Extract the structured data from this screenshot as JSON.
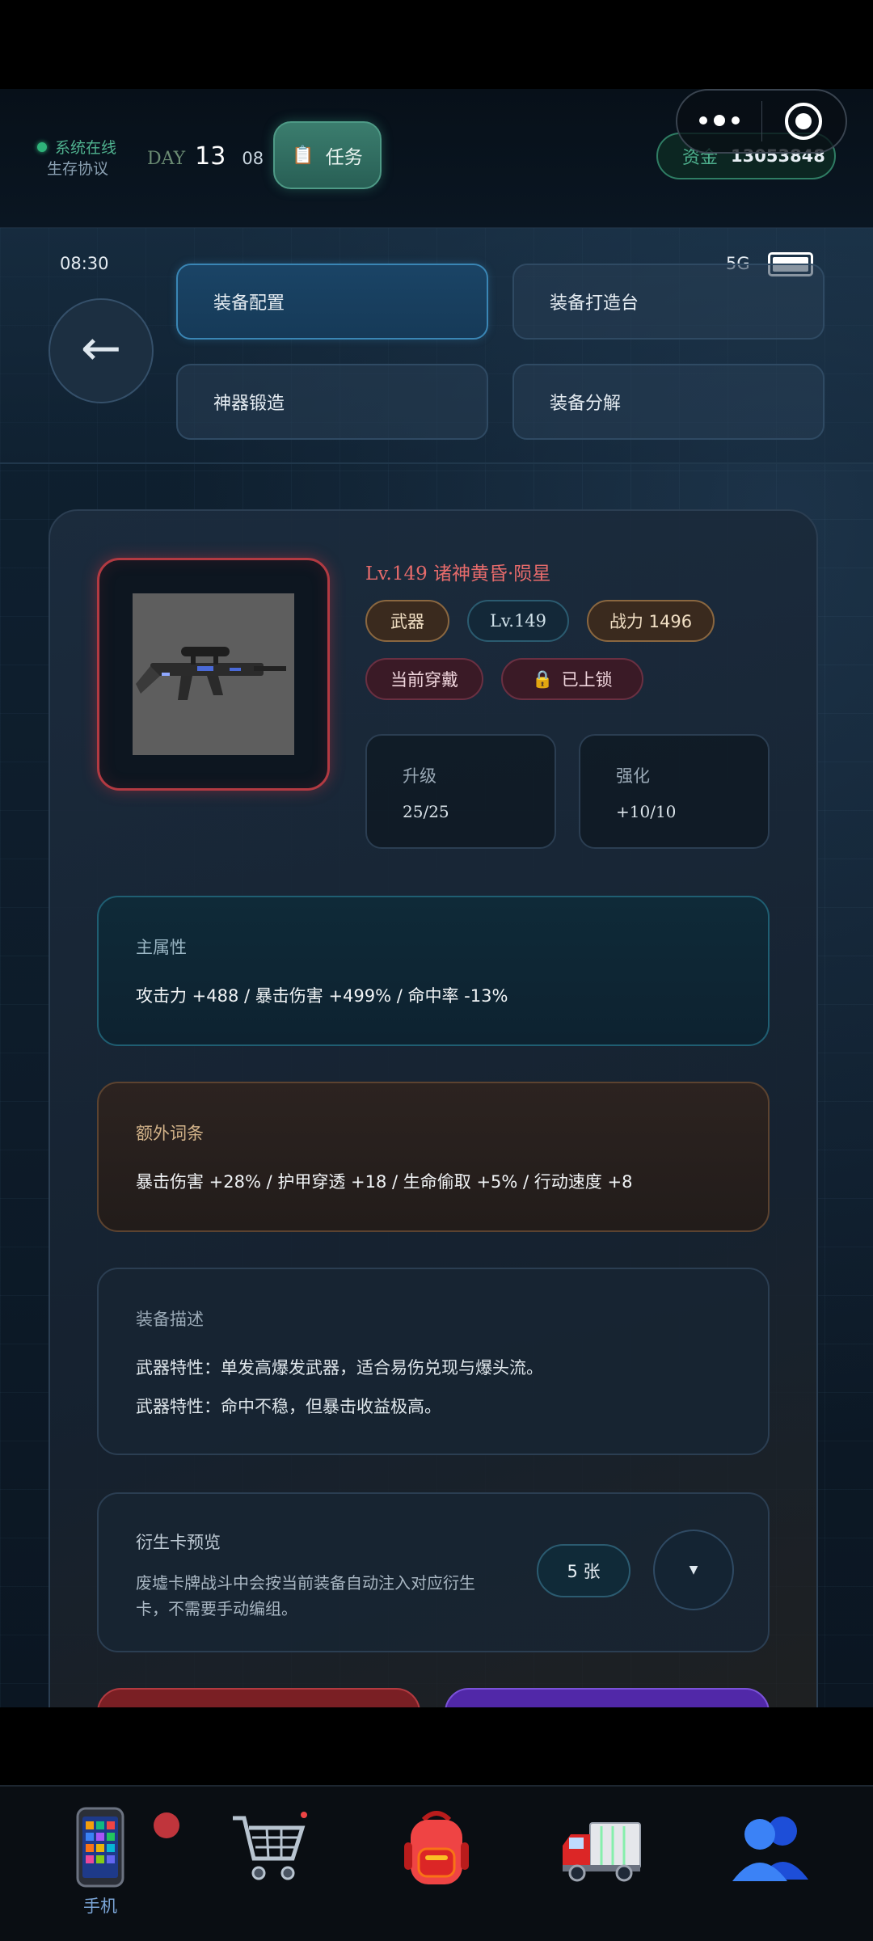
{
  "header": {
    "system_status": "系统在线",
    "protocol": "生存协议",
    "day_label": "DAY",
    "day_number": "13",
    "hour": "08",
    "task_button": "任务",
    "funds_label": "资金",
    "funds_value": "13053848"
  },
  "phone_status": {
    "time": "08:30",
    "network": "5G"
  },
  "nav": {
    "tiles": [
      {
        "label": "装备配置"
      },
      {
        "label": "装备打造台"
      },
      {
        "label": "神器锻造"
      },
      {
        "label": "装备分解"
      }
    ]
  },
  "item": {
    "title": "Lv.149 诸神黄昏·陨星",
    "tags": {
      "type": "武器",
      "level": "Lv.149",
      "power": "战力 1496",
      "equipped": "当前穿戴",
      "locked": "已上锁"
    },
    "upgrade_label": "升级",
    "upgrade_value": "25/25",
    "enhance_label": "强化",
    "enhance_value": "+10/10"
  },
  "sections": {
    "main_title": "主属性",
    "main_body": "攻击力 +488 / 暴击伤害 +499% / 命中率 -13%",
    "extra_title": "额外词条",
    "extra_body": "暴击伤害 +28% / 护甲穿透 +18 / 生命偷取 +5% / 行动速度 +8",
    "desc_title": "装备描述",
    "desc_line1": "武器特性：单发高爆发武器，适合易伤兑现与爆头流。",
    "desc_line2": "武器特性：命中不稳，但暴击收益极高。",
    "deriv_title": "衍生卡预览",
    "deriv_body1": "废墟卡牌战斗中会按当前装备自动注入对应衍生",
    "deriv_body2": "卡，不需要手动编组。",
    "deriv_count": "5 张",
    "expand_glyph": "▼"
  },
  "bottom_nav": {
    "phone_label": "手机"
  },
  "colors": {
    "accent_teal": "#2fb37a",
    "accent_red": "#b23a42",
    "nav_active": "#3a86b5"
  }
}
